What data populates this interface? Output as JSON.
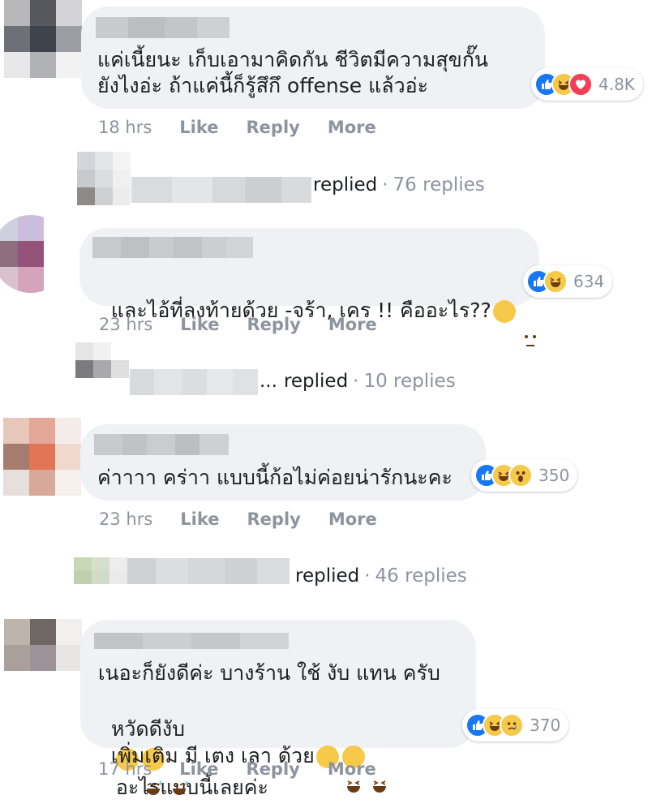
{
  "comments": [
    {
      "text_lines": [
        "แค่เนี้ยนะ เก็บเอามาคิดกัน ชีวิตมีความสุขกั๊น",
        "ยังไงอ่ะ ถ้าแค่นี้ก็รู้สึกึ offense แล้วอ่ะ"
      ],
      "reaction_count": "4.8K",
      "reactions": [
        "like-icon",
        "haha-icon",
        "love-icon"
      ],
      "time": "18 hrs",
      "actions": [
        "Like",
        "Reply",
        "More"
      ],
      "replies": {
        "prefix": "",
        "replied": "replied",
        "sep": "·",
        "count": "76 replies"
      }
    },
    {
      "text_lines": [
        "และไอ้ที่ลงท้ายด้วย -จร้า, เคร !! คืออะไร??"
      ],
      "reaction_count": "634",
      "reactions": [
        "like-icon",
        "haha-icon"
      ],
      "time": "23 hrs",
      "actions": [
        "Like",
        "Reply",
        "More"
      ],
      "replies": {
        "prefix": "...",
        "replied": "replied",
        "sep": "·",
        "count": "10 replies"
      }
    },
    {
      "text_lines": [
        "ค่าาาา คร่าา แบบนี้ก้อไม่ค่อยน่ารักนะคะ"
      ],
      "reaction_count": "350",
      "reactions": [
        "like-icon",
        "haha-icon",
        "wow-icon"
      ],
      "time": "23 hrs",
      "actions": [
        "Like",
        "Reply",
        "More"
      ],
      "replies": {
        "prefix": "",
        "replied": "replied",
        "sep": "·",
        "count": "46 replies"
      }
    },
    {
      "text_lines": [
        "เนอะก็ยังดีค่ะ บางร้าน ใช้ งับ แทน ครับ",
        "หวัดดีงับ",
        "เพิ่มเติม มี เตง เลา ด้วย"
      ],
      "reaction_count": "370",
      "reactions": [
        "like-icon",
        "haha-icon",
        "sad-icon"
      ],
      "time": "17 hrs",
      "actions": [
        "Like",
        "Reply",
        "More"
      ]
    }
  ],
  "inline_emoji": {
    "line2_a": "อะไรแบบนี้เลยค่ะ"
  },
  "colors": {
    "bubble": "#eff1f4",
    "meta": "#8d949e",
    "like": "#1877f2",
    "haha": "#f7c94b",
    "love": "#f33e58"
  }
}
